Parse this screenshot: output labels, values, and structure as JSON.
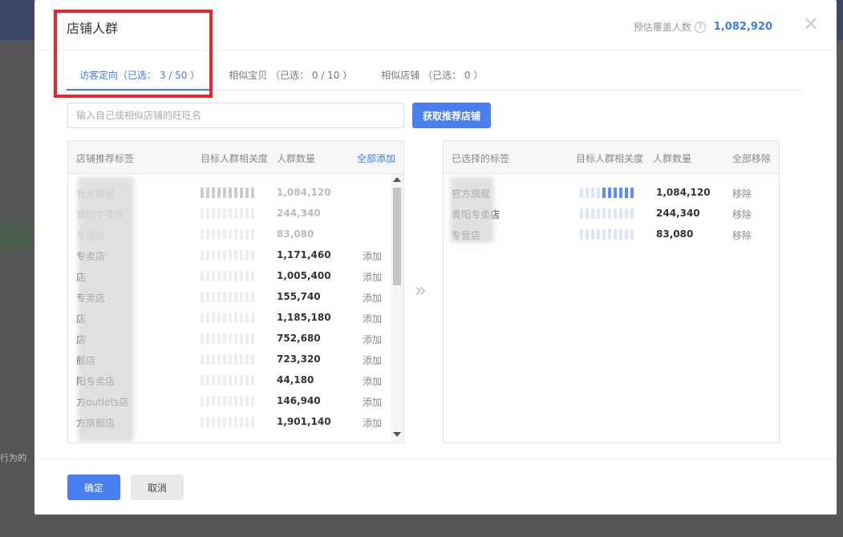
{
  "modal": {
    "title": "店铺人群",
    "coverage_label": "预估覆盖人数",
    "coverage_help": "?",
    "coverage_value": "1,082,920",
    "close_glyph": "✕"
  },
  "tabs": [
    {
      "label": "访客定向（已选： 3 / 50 ）"
    },
    {
      "label": "相似宝贝 （已选： 0 / 10 ）"
    },
    {
      "label": "相似店铺 （已选： 0 ）"
    }
  ],
  "search": {
    "placeholder": "输入自己或相似店铺的旺旺名",
    "button_label": "获取推荐店铺"
  },
  "left_panel": {
    "col_tag": "店铺推荐标签",
    "col_relevance": "目标人群相关度",
    "col_count": "人群数量",
    "add_all": "全部添加",
    "rows": [
      {
        "name": "官方旗舰",
        "count": "1,084,120",
        "action": "",
        "level": 1.0,
        "disabled": true
      },
      {
        "name": "青阳专卖店",
        "count": "244,340",
        "action": "",
        "level": 0.0,
        "disabled": true
      },
      {
        "name": "专营店",
        "count": "83,080",
        "action": "",
        "level": 0.0,
        "disabled": true
      },
      {
        "name": "专卖店",
        "count": "1,171,460",
        "action": "添加",
        "level": 0.0,
        "disabled": false
      },
      {
        "name": "店",
        "count": "1,005,400",
        "action": "添加",
        "level": 0.0,
        "disabled": false
      },
      {
        "name": "专卖店",
        "count": "155,740",
        "action": "添加",
        "level": 0.0,
        "disabled": false
      },
      {
        "name": "店",
        "count": "1,185,180",
        "action": "添加",
        "level": 0.0,
        "disabled": false
      },
      {
        "name": "店",
        "count": "752,680",
        "action": "添加",
        "level": 0.0,
        "disabled": false
      },
      {
        "name": "舰店",
        "count": "723,320",
        "action": "添加",
        "level": 0.0,
        "disabled": false
      },
      {
        "name": "阳专卖店",
        "count": "44,180",
        "action": "添加",
        "level": 0.0,
        "disabled": false
      },
      {
        "name": "方outlets店",
        "count": "146,940",
        "action": "添加",
        "level": 0.0,
        "disabled": false
      },
      {
        "name": "方旗舰店",
        "count": "1,901,140",
        "action": "添加",
        "level": 0.0,
        "disabled": false
      }
    ]
  },
  "transfer_glyph": "»",
  "right_panel": {
    "col_tag": "已选择的标签",
    "col_relevance": "目标人群相关度",
    "col_count": "人群数量",
    "remove_all": "全部移除",
    "rows": [
      {
        "name": "官方旗舰",
        "count": "1,084,120",
        "action": "移除",
        "level": 0.6
      },
      {
        "name": "青阳专卖店",
        "count": "244,340",
        "action": "移除",
        "level": 0.0
      },
      {
        "name": "专营店",
        "count": "83,080",
        "action": "移除",
        "level": 0.0
      }
    ]
  },
  "footer": {
    "ok_label": "确定",
    "cancel_label": "取消"
  },
  "background": {
    "side_text": "行为的"
  },
  "colors": {
    "accent": "#4a7ff0",
    "highlight": "#e8262b"
  }
}
